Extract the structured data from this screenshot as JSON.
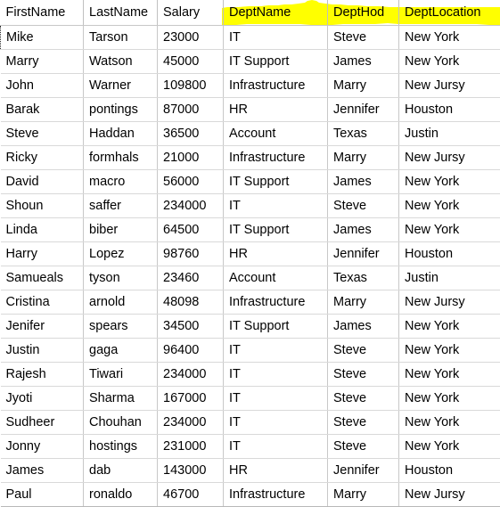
{
  "spreadsheet": {
    "highlight_color": "#ffff00",
    "selection_color": "#dce3ec",
    "grid_line_color": "#d9d9d9",
    "text_color": "#000000",
    "active_cell_value": "Mike",
    "columns": [
      {
        "key": "FirstName",
        "label": "FirstName",
        "highlighted": false
      },
      {
        "key": "LastName",
        "label": "LastName",
        "highlighted": false
      },
      {
        "key": "Salary",
        "label": "Salary",
        "highlighted": false
      },
      {
        "key": "DeptName",
        "label": "DeptName",
        "highlighted": true
      },
      {
        "key": "DeptHod",
        "label": "DeptHod",
        "highlighted": true
      },
      {
        "key": "DeptLocation",
        "label": "DeptLocation",
        "highlighted": true
      }
    ],
    "rows": [
      {
        "FirstName": "Mike",
        "LastName": "Tarson",
        "Salary": "23000",
        "DeptName": "IT",
        "DeptHod": "Steve",
        "DeptLocation": "New York"
      },
      {
        "FirstName": "Marry",
        "LastName": "Watson",
        "Salary": "45000",
        "DeptName": "IT Support",
        "DeptHod": "James",
        "DeptLocation": "New York"
      },
      {
        "FirstName": "John",
        "LastName": "Warner",
        "Salary": "109800",
        "DeptName": "Infrastructure",
        "DeptHod": "Marry",
        "DeptLocation": "New Jursy"
      },
      {
        "FirstName": "Barak",
        "LastName": "pontings",
        "Salary": "87000",
        "DeptName": "HR",
        "DeptHod": "Jennifer",
        "DeptLocation": "Houston"
      },
      {
        "FirstName": "Steve",
        "LastName": "Haddan",
        "Salary": "36500",
        "DeptName": "Account",
        "DeptHod": "Texas",
        "DeptLocation": "Justin"
      },
      {
        "FirstName": "Ricky",
        "LastName": "formhals",
        "Salary": "21000",
        "DeptName": "Infrastructure",
        "DeptHod": "Marry",
        "DeptLocation": "New Jursy"
      },
      {
        "FirstName": "David",
        "LastName": "macro",
        "Salary": "56000",
        "DeptName": "IT Support",
        "DeptHod": "James",
        "DeptLocation": "New York"
      },
      {
        "FirstName": "Shoun",
        "LastName": "saffer",
        "Salary": "234000",
        "DeptName": "IT",
        "DeptHod": "Steve",
        "DeptLocation": "New York"
      },
      {
        "FirstName": "Linda",
        "LastName": "biber",
        "Salary": "64500",
        "DeptName": "IT Support",
        "DeptHod": "James",
        "DeptLocation": "New York"
      },
      {
        "FirstName": "Harry",
        "LastName": "Lopez",
        "Salary": "98760",
        "DeptName": "HR",
        "DeptHod": "Jennifer",
        "DeptLocation": "Houston"
      },
      {
        "FirstName": "Samueals",
        "LastName": "tyson",
        "Salary": "23460",
        "DeptName": "Account",
        "DeptHod": "Texas",
        "DeptLocation": "Justin"
      },
      {
        "FirstName": "Cristina",
        "LastName": "arnold",
        "Salary": "48098",
        "DeptName": "Infrastructure",
        "DeptHod": "Marry",
        "DeptLocation": "New Jursy"
      },
      {
        "FirstName": "Jenifer",
        "LastName": "spears",
        "Salary": "34500",
        "DeptName": "IT Support",
        "DeptHod": "James",
        "DeptLocation": "New York"
      },
      {
        "FirstName": "Justin",
        "LastName": "gaga",
        "Salary": "96400",
        "DeptName": "IT",
        "DeptHod": "Steve",
        "DeptLocation": "New York"
      },
      {
        "FirstName": "Rajesh",
        "LastName": "Tiwari",
        "Salary": "234000",
        "DeptName": "IT",
        "DeptHod": "Steve",
        "DeptLocation": "New York"
      },
      {
        "FirstName": "Jyoti",
        "LastName": "Sharma",
        "Salary": "167000",
        "DeptName": "IT",
        "DeptHod": "Steve",
        "DeptLocation": "New York"
      },
      {
        "FirstName": "Sudheer",
        "LastName": "Chouhan",
        "Salary": "234000",
        "DeptName": "IT",
        "DeptHod": "Steve",
        "DeptLocation": "New York"
      },
      {
        "FirstName": "Jonny",
        "LastName": "hostings",
        "Salary": "231000",
        "DeptName": "IT",
        "DeptHod": "Steve",
        "DeptLocation": "New York"
      },
      {
        "FirstName": "James",
        "LastName": "dab",
        "Salary": "143000",
        "DeptName": "HR",
        "DeptHod": "Jennifer",
        "DeptLocation": "Houston"
      },
      {
        "FirstName": "Paul",
        "LastName": "ronaldo",
        "Salary": "46700",
        "DeptName": "Infrastructure",
        "DeptHod": "Marry",
        "DeptLocation": "New Jursy"
      }
    ]
  }
}
